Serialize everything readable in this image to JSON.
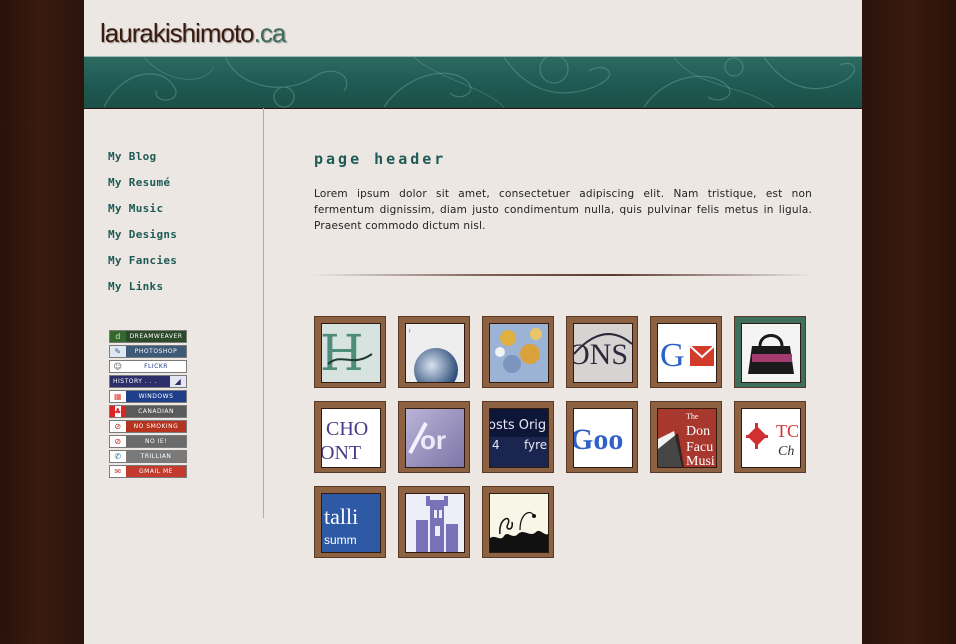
{
  "site": {
    "logo_name": "laurakishimoto",
    "logo_tld": ".ca"
  },
  "nav": [
    {
      "label": "My Blog"
    },
    {
      "label": "My Resumé"
    },
    {
      "label": "My Music"
    },
    {
      "label": "My Designs"
    },
    {
      "label": "My Fancies"
    },
    {
      "label": "My Links"
    }
  ],
  "badges": [
    {
      "label": "DREAMWEAVER",
      "color": "#2c4a2a",
      "icon": "dreamweaver-icon"
    },
    {
      "label": "PHOTOSHOP",
      "color": "#3d5a78",
      "icon": "photoshop-icon"
    },
    {
      "label": "FLICKR",
      "color": "#ffffff",
      "icon": "flickr-icon"
    },
    {
      "label": "HISTORY . . .",
      "color": "#2c2f6a",
      "icon": "history-icon"
    },
    {
      "label": "WINDOWS",
      "color": "#1f3f8a",
      "icon": "windows-icon"
    },
    {
      "label": "CANADIAN",
      "color": "#5a5a5a",
      "icon": "canada-flag-icon"
    },
    {
      "label": "NO SMOKING",
      "color": "#b5331f",
      "icon": "no-smoking-icon"
    },
    {
      "label": "NO IE!",
      "color": "#6a6a6a",
      "icon": "no-ie-icon"
    },
    {
      "label": "TRILLIAN",
      "color": "#7a7a7a",
      "icon": "trillian-icon"
    },
    {
      "label": "GMAIL ME",
      "color": "#c23b2e",
      "icon": "gmail-icon"
    }
  ],
  "content": {
    "title": "page header",
    "body": "Lorem ipsum dolor sit amet, consectetuer adipiscing elit. Nam tristique, est non fermentum dignissim, diam justo condimentum nulla, quis pulvinar felis metus in ligula. Praesent commodo dictum nisl."
  },
  "thumbnails": [
    {
      "name": "thumbnail-1",
      "text": "H"
    },
    {
      "name": "thumbnail-2",
      "text": "'"
    },
    {
      "name": "thumbnail-3",
      "text": ""
    },
    {
      "name": "thumbnail-4",
      "text": "ONS"
    },
    {
      "name": "thumbnail-5",
      "text": "G"
    },
    {
      "name": "thumbnail-6",
      "text": ""
    },
    {
      "name": "thumbnail-7",
      "text": "CHO"
    },
    {
      "name": "thumbnail-8",
      "text": "or"
    },
    {
      "name": "thumbnail-9",
      "text": "osts Orig"
    },
    {
      "name": "thumbnail-10",
      "text": "Goo"
    },
    {
      "name": "thumbnail-11",
      "text": "The Don Facu Musi"
    },
    {
      "name": "thumbnail-12",
      "text": "TC Ch"
    },
    {
      "name": "thumbnail-13",
      "text": "talli summ"
    },
    {
      "name": "thumbnail-14",
      "text": ""
    },
    {
      "name": "thumbnail-15",
      "text": ""
    }
  ]
}
